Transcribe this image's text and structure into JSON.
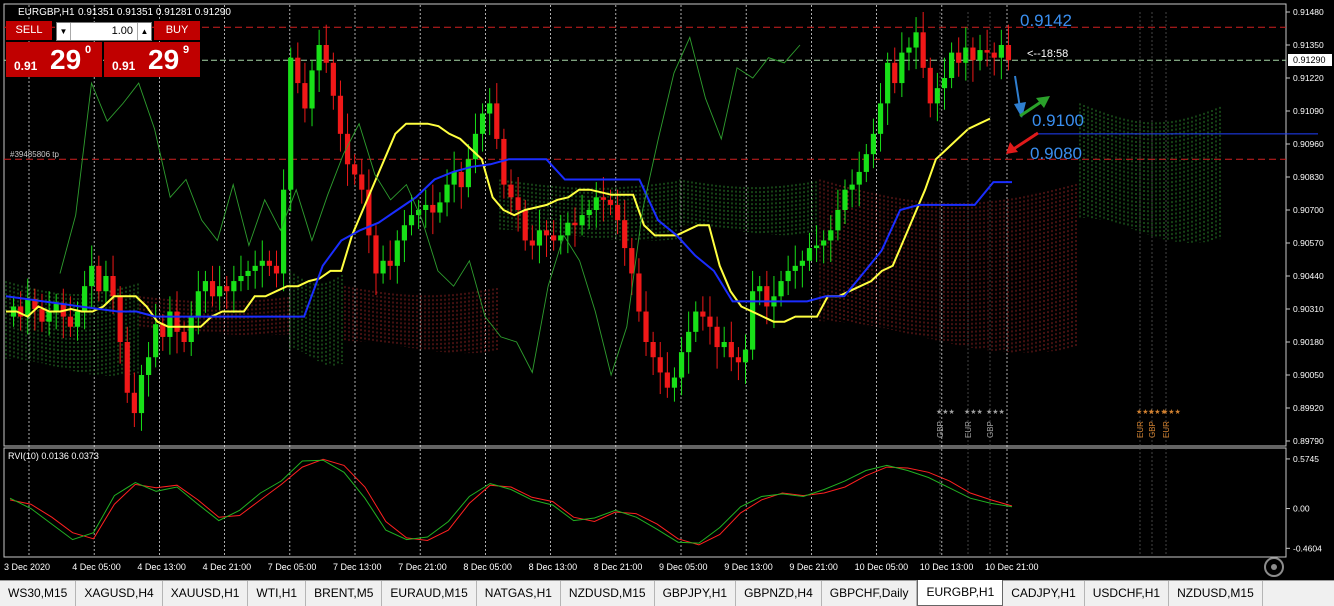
{
  "header": {
    "symbol_label": "EURGBP,H1",
    "ohlc_text": "0.91351 0.91351 0.91281 0.91290"
  },
  "trade_panel": {
    "sell_label": "SELL",
    "buy_label": "BUY",
    "lot_value": "1.00",
    "sell_price_small": "0.91",
    "sell_price_big": "29",
    "sell_price_sup": "0",
    "buy_price_small": "0.91",
    "buy_price_big": "29",
    "buy_price_sup": "9"
  },
  "annotations": {
    "level_top": "0.9142",
    "level_mid": "0.9100",
    "level_low": "0.9080",
    "timer": "<--18:58",
    "tp_label": "#39485806 tp",
    "current_price": "0.91290"
  },
  "rvi": {
    "label": "RVI(10) 0.0136 0.0373",
    "ticks": [
      "0.5745",
      "0.00",
      "-0.4604"
    ]
  },
  "events": [
    {
      "currency": "GBP",
      "stars": "★★★"
    },
    {
      "currency": "EUR",
      "stars": "★★★"
    },
    {
      "currency": "GBP",
      "stars": "★★★"
    },
    {
      "currency": "EUR",
      "stars": "★★★"
    },
    {
      "currency": "GBP",
      "stars": "★★★"
    },
    {
      "currency": "EUR",
      "stars": "★★★"
    }
  ],
  "chart_data": {
    "type": "candlestick",
    "price_ticks": [
      "0.91480",
      "0.91350",
      "0.91220",
      "0.91090",
      "0.90960",
      "0.90830",
      "0.90700",
      "0.90570",
      "0.90440",
      "0.90310",
      "0.90180",
      "0.90050",
      "0.89920",
      "0.89790"
    ],
    "ylim": [
      0.8979,
      0.9148
    ],
    "time_labels": [
      "3 Dec 2020",
      "4 Dec 05:00",
      "4 Dec 13:00",
      "4 Dec 21:00",
      "7 Dec 05:00",
      "7 Dec 13:00",
      "7 Dec 21:00",
      "8 Dec 05:00",
      "8 Dec 13:00",
      "8 Dec 21:00",
      "9 Dec 05:00",
      "9 Dec 13:00",
      "9 Dec 21:00",
      "10 Dec 05:00",
      "10 Dec 13:00",
      "10 Dec 21:00"
    ],
    "horizontal_levels": [
      0.9142,
      0.9129,
      0.91,
      0.909
    ],
    "candles_close": [
      0.9032,
      0.9028,
      0.9035,
      0.9031,
      0.9026,
      0.903,
      0.9033,
      0.9028,
      0.9024,
      0.903,
      0.904,
      0.9048,
      0.9038,
      0.9044,
      0.9036,
      0.9018,
      0.8998,
      0.899,
      0.9005,
      0.9012,
      0.9025,
      0.902,
      0.903,
      0.9022,
      0.9018,
      0.9028,
      0.9038,
      0.9042,
      0.9036,
      0.904,
      0.9038,
      0.9042,
      0.9044,
      0.9046,
      0.9048,
      0.905,
      0.9048,
      0.9045,
      0.9078,
      0.913,
      0.912,
      0.911,
      0.9125,
      0.9135,
      0.9128,
      0.9115,
      0.91,
      0.9088,
      0.9084,
      0.9078,
      0.906,
      0.9045,
      0.905,
      0.9048,
      0.9058,
      0.9064,
      0.9068,
      0.907,
      0.9072,
      0.9069,
      0.9073,
      0.908,
      0.9085,
      0.9079,
      0.909,
      0.91,
      0.9108,
      0.9112,
      0.9098,
      0.908,
      0.9075,
      0.907,
      0.9058,
      0.9056,
      0.9062,
      0.906,
      0.9058,
      0.906,
      0.9065,
      0.9064,
      0.9068,
      0.907,
      0.9075,
      0.9074,
      0.9072,
      0.9066,
      0.9055,
      0.9045,
      0.903,
      0.9018,
      0.9012,
      0.9006,
      0.9,
      0.9004,
      0.9014,
      0.9022,
      0.903,
      0.9028,
      0.9024,
      0.9016,
      0.9018,
      0.9012,
      0.901,
      0.9015,
      0.9038,
      0.904,
      0.9032,
      0.9036,
      0.9042,
      0.9046,
      0.9048,
      0.905,
      0.9055,
      0.9056,
      0.9058,
      0.9062,
      0.907,
      0.9078,
      0.908,
      0.9085,
      0.9092,
      0.91,
      0.9112,
      0.9128,
      0.912,
      0.9132,
      0.9134,
      0.914,
      0.9126,
      0.9112,
      0.9118,
      0.9122,
      0.9132,
      0.9128,
      0.9134,
      0.9129,
      0.9133,
      0.9132,
      0.913,
      0.9135,
      0.9129
    ],
    "series": [
      {
        "name": "",
        "color": "#ffff40",
        "values": [
          0.903,
          0.903,
          0.9028,
          0.9032,
          0.903,
          0.903,
          0.9031,
          0.903,
          0.903,
          0.9032,
          0.9036,
          0.9036,
          0.9036,
          0.9032,
          0.9026,
          0.9024,
          0.9024,
          0.9024,
          0.9024,
          0.9028,
          0.903,
          0.903,
          0.903,
          0.9036,
          0.9036,
          0.9038,
          0.904,
          0.904,
          0.9042,
          0.9043,
          0.9046,
          0.9046,
          0.906,
          0.907,
          0.908,
          0.909,
          0.91,
          0.9104,
          0.9104,
          0.9104,
          0.9103,
          0.91,
          0.9098,
          0.9094,
          0.909,
          0.9075,
          0.907,
          0.9068,
          0.907,
          0.9071,
          0.9072,
          0.9074,
          0.9075,
          0.9078,
          0.9078,
          0.9077,
          0.9076,
          0.9076,
          0.9076,
          0.9064,
          0.906,
          0.906,
          0.906,
          0.9062,
          0.9064,
          0.9064,
          0.9048,
          0.9038,
          0.9032,
          0.903,
          0.9028,
          0.9026,
          0.9026,
          0.9028,
          0.9028,
          0.9028,
          0.9036,
          0.9036,
          0.9038,
          0.904,
          0.9042,
          0.9046,
          0.9048,
          0.9058,
          0.9068,
          0.9078,
          0.909,
          0.9094,
          0.9098,
          0.9102,
          0.9104,
          0.9106
        ]
      },
      {
        "name": "",
        "color": "#1a2dff",
        "values": [
          0.9036,
          0.9035,
          0.9034,
          0.9033,
          0.9032,
          0.9031,
          0.903,
          0.903,
          0.9028,
          0.9028,
          0.9028,
          0.9028,
          0.9028,
          0.9028,
          0.9028,
          0.9028,
          0.9028,
          0.9048,
          0.9058,
          0.9062,
          0.9065,
          0.907,
          0.9075,
          0.9082,
          0.9085,
          0.9087,
          0.9088,
          0.909,
          0.909,
          0.909,
          0.9082,
          0.9082,
          0.9082,
          0.9082,
          0.9082,
          0.9066,
          0.906,
          0.9052,
          0.9046,
          0.9034,
          0.9034,
          0.9034,
          0.9034,
          0.9034,
          0.9036,
          0.9036,
          0.9045,
          0.9054,
          0.907,
          0.9072,
          0.9072,
          0.9072,
          0.9072,
          0.9081,
          0.9081
        ]
      },
      {
        "name": "",
        "color": "#2e9e2e",
        "values": [
          0.9045,
          0.9068,
          0.912,
          0.9105,
          0.9112,
          0.912,
          0.9102,
          0.9075,
          0.9082,
          0.9066,
          0.9058,
          0.908,
          0.9056,
          0.9074,
          0.9062,
          0.9078,
          0.9058,
          0.9076,
          0.9092,
          0.9104,
          0.9084,
          0.9074,
          0.908,
          0.9066,
          0.9046,
          0.904,
          0.905,
          0.9028,
          0.902,
          0.9018,
          0.9006,
          0.904,
          0.906,
          0.905,
          0.903,
          0.9005,
          0.9024,
          0.907,
          0.9098,
          0.9124,
          0.9138,
          0.9114,
          0.9098,
          0.9126,
          0.9122,
          0.913,
          0.9128,
          0.9135
        ]
      }
    ],
    "rvi_series": [
      {
        "name": "",
        "color": "#ff2020",
        "values": [
          0.1,
          0.05,
          -0.1,
          -0.28,
          -0.35,
          0.05,
          0.28,
          0.24,
          0.27,
          0.1,
          -0.1,
          -0.08,
          0.1,
          0.28,
          0.48,
          0.57,
          0.5,
          0.25,
          -0.15,
          -0.34,
          -0.37,
          -0.25,
          0.06,
          0.27,
          0.25,
          0.13,
          0.08,
          -0.1,
          -0.15,
          -0.04,
          -0.06,
          -0.18,
          -0.35,
          -0.42,
          -0.3,
          -0.05,
          0.1,
          0.18,
          0.15,
          0.18,
          0.25,
          0.38,
          0.48,
          0.47,
          0.42,
          0.32,
          0.18,
          0.1,
          0.03
        ]
      },
      {
        "name": "",
        "color": "#21b021",
        "values": [
          0.12,
          0.0,
          -0.18,
          -0.36,
          -0.28,
          0.15,
          0.3,
          0.2,
          0.25,
          0.05,
          -0.14,
          -0.02,
          0.18,
          0.32,
          0.55,
          0.56,
          0.42,
          0.12,
          -0.25,
          -0.36,
          -0.33,
          -0.15,
          0.14,
          0.29,
          0.22,
          0.1,
          0.04,
          -0.14,
          -0.11,
          -0.02,
          -0.1,
          -0.24,
          -0.39,
          -0.4,
          -0.22,
          0.02,
          0.14,
          0.17,
          0.14,
          0.22,
          0.32,
          0.44,
          0.5,
          0.44,
          0.36,
          0.24,
          0.12,
          0.06,
          0.02
        ]
      }
    ]
  },
  "tabs": [
    "WS30,M15",
    "XAGUSD,H4",
    "XAUUSD,H1",
    "WTI,H1",
    "BRENT,M5",
    "EURAUD,M15",
    "NATGAS,H1",
    "NZDUSD,M15",
    "GBPJPY,H1",
    "GBPNZD,H4",
    "GBPCHF,Daily",
    "EURGBP,H1",
    "CADJPY,H1",
    "USDCHF,H1",
    "NZDUSD,M15"
  ],
  "active_tab": "EURGBP,H1"
}
